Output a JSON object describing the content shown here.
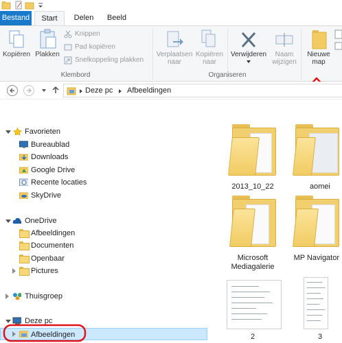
{
  "ribbon_tabs": {
    "file": "Bestand",
    "start": "Start",
    "share": "Delen",
    "view": "Beeld"
  },
  "ribbon": {
    "copy": "Kopiëren",
    "paste": "Plakken",
    "cut": "Knippen",
    "copy_path": "Pad kopiëren",
    "paste_shortcut": "Snelkoppeling plakken",
    "clipboard_group": "Klembord",
    "move_to_line1": "Verplaatsen",
    "move_to_line2": "naar",
    "copy_to_line1": "Kopiëren",
    "copy_to_line2": "naar",
    "delete": "Verwijderen",
    "rename_line1": "Naam",
    "rename_line2": "wijzigen",
    "organize_group": "Organiseren",
    "new_folder_line1": "Nieuwe",
    "new_folder_line2": "map"
  },
  "address": {
    "this_pc": "Deze pc",
    "pictures": "Afbeeldingen"
  },
  "nav": {
    "favorites": "Favorieten",
    "fav_items": [
      "Bureaublad",
      "Downloads",
      "Google Drive",
      "Recente locaties",
      "SkyDrive"
    ],
    "onedrive": "OneDrive",
    "onedrive_items": [
      "Afbeeldingen",
      "Documenten",
      "Openbaar",
      "Pictures"
    ],
    "homegroup": "Thuisgroep",
    "this_pc": "Deze pc",
    "this_pc_items": [
      "Afbeeldingen"
    ]
  },
  "files": [
    "2013_10_22",
    "aomei",
    "Microsoft Mediagalerie",
    "MP Navigator E",
    "2",
    "3"
  ],
  "colors": {
    "file_tab": "#1979ca",
    "selection": "#cce8ff",
    "highlight_circle": "#e0121a",
    "arrow": "#e0121a"
  }
}
